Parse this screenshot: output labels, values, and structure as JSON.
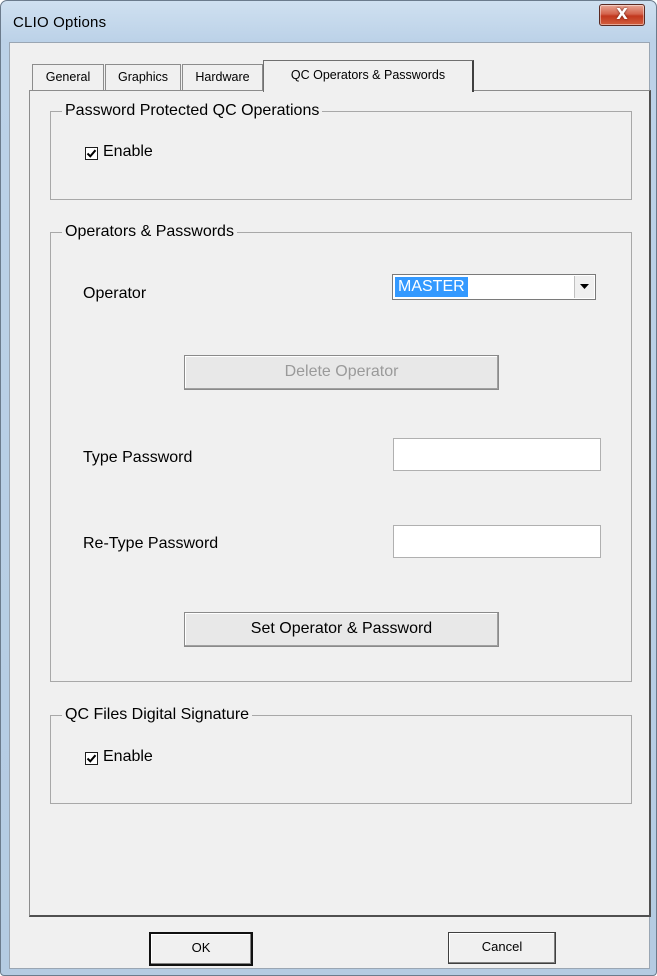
{
  "window": {
    "title": "CLIO Options",
    "close_glyph": "X"
  },
  "tabs": [
    {
      "label": "General",
      "active": false
    },
    {
      "label": "Graphics",
      "active": false
    },
    {
      "label": "Hardware",
      "active": false
    },
    {
      "label": "QC Operators & Passwords",
      "active": true
    }
  ],
  "password_protected": {
    "legend": "Password Protected QC Operations",
    "enable_label": "Enable",
    "enabled": true
  },
  "operators": {
    "legend": "Operators & Passwords",
    "operator_label": "Operator",
    "operator_value": "MASTER",
    "delete_button": "Delete Operator",
    "type_password_label": "Type Password",
    "type_password_value": "",
    "retype_password_label": "Re-Type Password",
    "retype_password_value": "",
    "set_button": "Set Operator & Password"
  },
  "digital_signature": {
    "legend": "QC Files Digital Signature",
    "enable_label": "Enable",
    "enabled": true
  },
  "footer": {
    "ok_label": "OK",
    "cancel_label": "Cancel"
  },
  "colors": {
    "selection": "#3399ff",
    "close_button": "#c2381e"
  }
}
